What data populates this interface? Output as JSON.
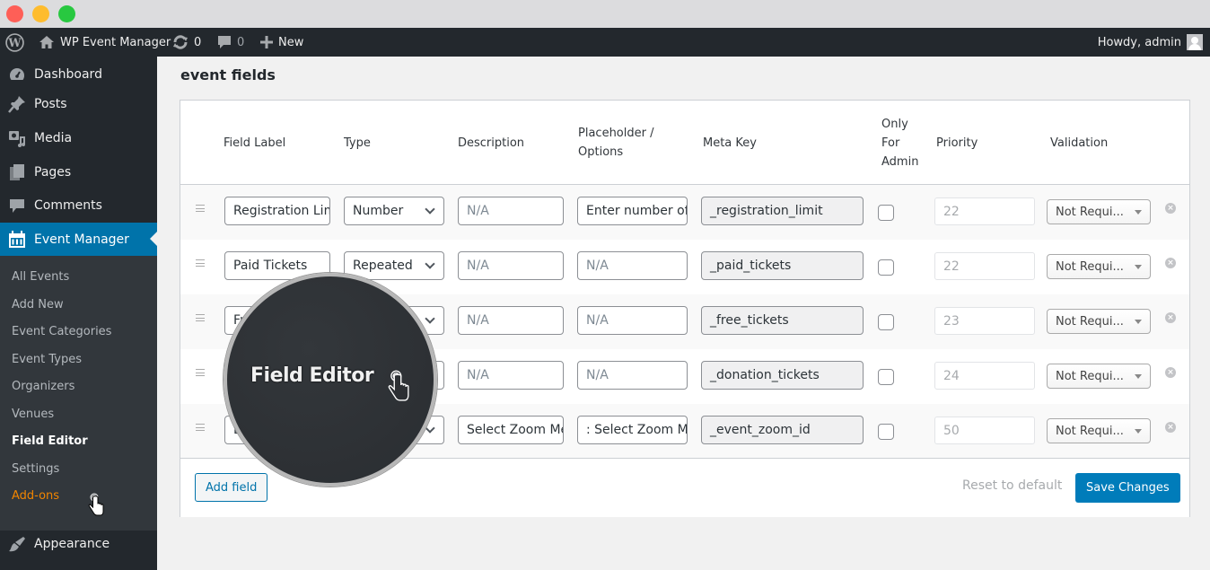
{
  "window": {
    "controls": [
      "close",
      "minimize",
      "maximize"
    ]
  },
  "admin_bar": {
    "site_name": "WP Event Manager",
    "updates_count": "0",
    "comments_count": "0",
    "new_label": "New",
    "howdy": "Howdy, admin"
  },
  "sidebar": {
    "items": [
      {
        "label": "Dashboard",
        "icon": "dashboard-icon"
      },
      {
        "label": "Posts",
        "icon": "pin-icon"
      },
      {
        "label": "Media",
        "icon": "media-icon"
      },
      {
        "label": "Pages",
        "icon": "pages-icon"
      },
      {
        "label": "Comments",
        "icon": "comment-icon"
      },
      {
        "label": "Event Manager",
        "icon": "calendar-icon",
        "active": true
      }
    ],
    "submenu": [
      {
        "label": "All Events"
      },
      {
        "label": "Add New"
      },
      {
        "label": "Event Categories"
      },
      {
        "label": "Event Types"
      },
      {
        "label": "Organizers"
      },
      {
        "label": "Venues"
      },
      {
        "label": "Field Editor",
        "current": true
      },
      {
        "label": "Settings"
      },
      {
        "label": "Add-ons"
      }
    ],
    "appearance": {
      "label": "Appearance",
      "icon": "brush-icon"
    }
  },
  "main": {
    "title": "event fields",
    "columns": {
      "field_label": "Field Label",
      "type": "Type",
      "description": "Description",
      "placeholder_1": "Placeholder /",
      "placeholder_2": "Options",
      "meta_key": "Meta Key",
      "only_1": "Only",
      "only_2": "For",
      "only_3": "Admin",
      "priority": "Priority",
      "validation": "Validation"
    },
    "rows": [
      {
        "label": "Registration Limit",
        "type": "Number",
        "description": "N/A",
        "placeholder": "Enter number of",
        "meta_key": "_registration_limit",
        "only_admin": false,
        "priority": "22",
        "validation": "Not Requi..."
      },
      {
        "label": "Paid Tickets",
        "type": "Repeated",
        "description": "N/A",
        "placeholder": "N/A",
        "meta_key": "_paid_tickets",
        "only_admin": false,
        "priority": "22",
        "validation": "Not Requi..."
      },
      {
        "label": "Fr",
        "type": "",
        "description": "N/A",
        "placeholder": "N/A",
        "meta_key": "_free_tickets",
        "only_admin": false,
        "priority": "23",
        "validation": "Not Requi..."
      },
      {
        "label": "",
        "type": "",
        "description": "N/A",
        "placeholder": "N/A",
        "meta_key": "_donation_tickets",
        "only_admin": false,
        "priority": "24",
        "validation": "Not Requi..."
      },
      {
        "label": "E",
        "type": "",
        "description": "Select Zoom Meeting",
        "placeholder": ": Select Zoom Meeting",
        "meta_key": "_event_zoom_id",
        "only_admin": false,
        "priority": "50",
        "validation": "Not Requi..."
      }
    ],
    "footer": {
      "add_field": "Add field",
      "reset": "Reset to default",
      "save": "Save Changes"
    }
  },
  "magnifier": {
    "label": "Field Editor"
  }
}
